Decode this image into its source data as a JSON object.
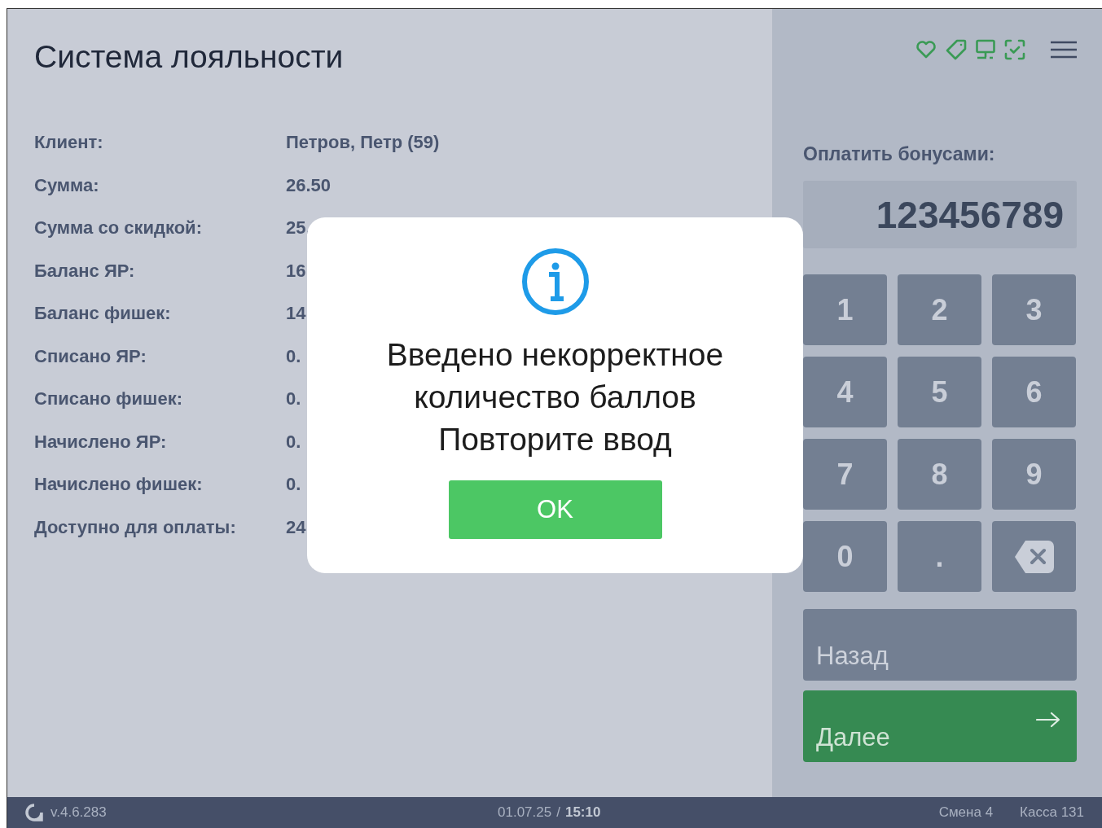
{
  "title": "Система лояльности",
  "details": [
    {
      "label": "Клиент:",
      "value": "Петров, Петр (59)"
    },
    {
      "label": "Сумма:",
      "value": "26.50"
    },
    {
      "label": "Сумма со скидкой:",
      "value": "25."
    },
    {
      "label": "Баланс ЯР:",
      "value": "16"
    },
    {
      "label": "Баланс фишек:",
      "value": "14"
    },
    {
      "label": "Списано ЯР:",
      "value": "0."
    },
    {
      "label": "Списано фишек:",
      "value": "0."
    },
    {
      "label": "Начислено ЯР:",
      "value": "0."
    },
    {
      "label": "Начислено фишек:",
      "value": "0."
    },
    {
      "label": "Доступно для оплаты:",
      "value": "24"
    }
  ],
  "payment": {
    "label": "Оплатить бонусами:",
    "value": "123456789"
  },
  "keypad": [
    {
      "kind": "digit",
      "label": "1"
    },
    {
      "kind": "digit",
      "label": "2"
    },
    {
      "kind": "digit",
      "label": "3"
    },
    {
      "kind": "digit",
      "label": "4"
    },
    {
      "kind": "digit",
      "label": "5"
    },
    {
      "kind": "digit",
      "label": "6"
    },
    {
      "kind": "digit",
      "label": "7"
    },
    {
      "kind": "digit",
      "label": "8"
    },
    {
      "kind": "digit",
      "label": "9"
    },
    {
      "kind": "digit",
      "label": "0"
    },
    {
      "kind": "digit",
      "label": "."
    },
    {
      "kind": "backspace"
    }
  ],
  "back_button": "Назад",
  "next_button": "Далее",
  "dialog": {
    "message": "Введено некорректное\nколичество баллов\nПовторите ввод",
    "button": "OK"
  },
  "status_bar": {
    "version": "v.4.6.283",
    "date": "01.07.25",
    "separator": "/",
    "time": "15:10",
    "shift": "Смена 4",
    "register": "Касса 131"
  }
}
